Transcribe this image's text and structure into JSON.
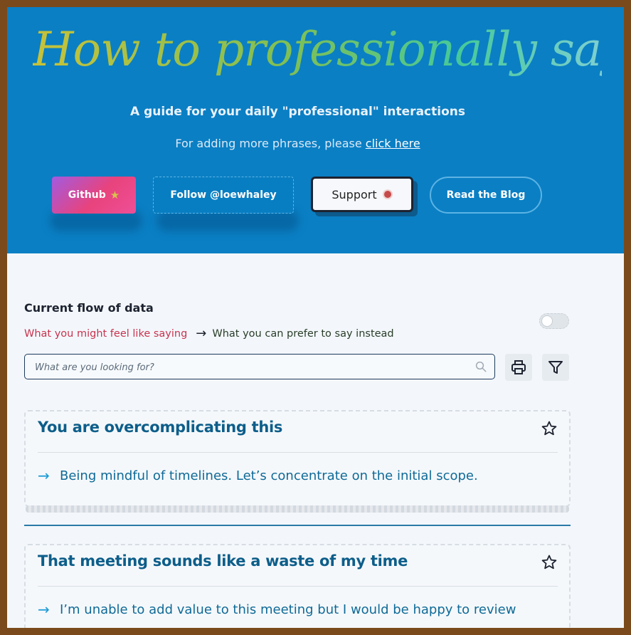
{
  "hero": {
    "title": "How to professionally say",
    "subtitle": "A guide for your daily \"professional\" interactions",
    "note_prefix": "For adding more phrases, please ",
    "note_link": "click here",
    "buttons": {
      "github": "Github",
      "follow": "Follow @loewhaley",
      "support": "Support",
      "blog": "Read the Blog"
    }
  },
  "flow": {
    "title": "Current flow of data",
    "feel_label": "What you might feel like saying",
    "prefer_label": "What you can prefer to say instead",
    "toggle_on": false
  },
  "search": {
    "placeholder": "What are you looking for?"
  },
  "cards": [
    {
      "title": "You are overcomplicating this",
      "phrase": "Being mindful of timelines. Let’s concentrate on the initial scope."
    },
    {
      "title": "That meeting sounds like a waste of my time",
      "phrase": "I’m unable to add value to this meeting but I would be happy to review"
    }
  ],
  "colors": {
    "hero_bg": "#0a7fc4",
    "page_bg": "#f3f7fb",
    "card_title": "#0d5e8a",
    "phrase": "#0f6a97",
    "feel_label": "#c8334f"
  },
  "icons": [
    "star-icon",
    "coffee-icon",
    "arrow-right-icon",
    "search-icon",
    "print-icon",
    "filter-icon",
    "star-outline-icon"
  ]
}
